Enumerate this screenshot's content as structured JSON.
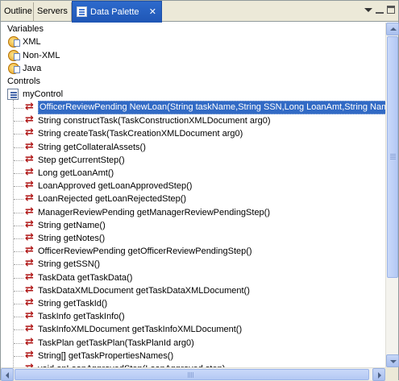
{
  "tabs": {
    "outline": "Outline",
    "servers": "Servers",
    "data_palette": "Data Palette",
    "close_glyph": "✕"
  },
  "tree": {
    "variables_label": "Variables",
    "xml_label": "XML",
    "nonxml_label": "Non-XML",
    "java_label": "Java",
    "controls_label": "Controls",
    "control_name": "myControl",
    "methods": [
      "OfficerReviewPending NewLoan(String taskName,String SSN,Long LoanAmt,String Name)",
      "String constructTask(TaskConstructionXMLDocument arg0)",
      "String createTask(TaskCreationXMLDocument arg0)",
      "String getCollateralAssets()",
      "Step getCurrentStep()",
      "Long getLoanAmt()",
      "LoanApproved getLoanApprovedStep()",
      "LoanRejected getLoanRejectedStep()",
      "ManagerReviewPending getManagerReviewPendingStep()",
      "String getName()",
      "String getNotes()",
      "OfficerReviewPending getOfficerReviewPendingStep()",
      "String getSSN()",
      "TaskData getTaskData()",
      "TaskDataXMLDocument getTaskDataXMLDocument()",
      "String getTaskId()",
      "TaskInfo getTaskInfo()",
      "TaskInfoXMLDocument getTaskInfoXMLDocument()",
      "TaskPlan getTaskPlan(TaskPlanId arg0)",
      "String[] getTaskPropertiesNames()",
      "void onLoanApprovedStep(LoanApproved step)"
    ],
    "selected_index": 0
  }
}
